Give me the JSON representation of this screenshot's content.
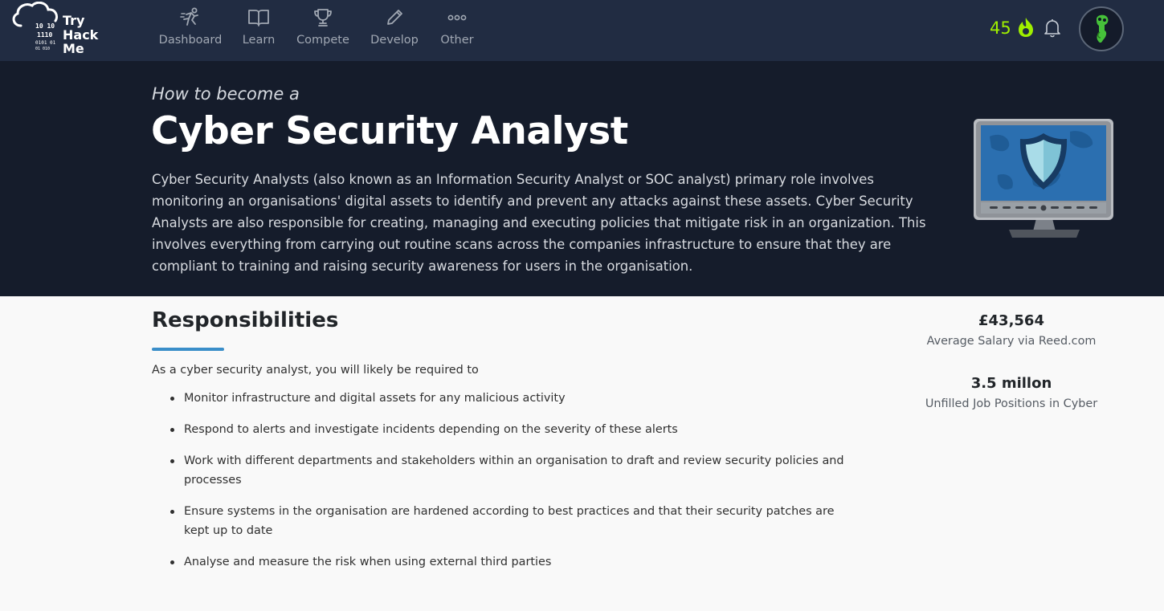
{
  "brand": {
    "logo_lines": [
      "Try",
      "Hack",
      "Me"
    ],
    "logo_binary": [
      "10  10",
      "1110",
      "0101  01",
      "01  010"
    ]
  },
  "nav": {
    "items": [
      {
        "label": "Dashboard",
        "icon": "runner-icon"
      },
      {
        "label": "Learn",
        "icon": "book-icon"
      },
      {
        "label": "Compete",
        "icon": "trophy-icon"
      },
      {
        "label": "Develop",
        "icon": "pencil-icon"
      },
      {
        "label": "Other",
        "icon": "dots-icon"
      }
    ],
    "streak": "45",
    "streak_icon": "flame-icon",
    "notification_icon": "bell-icon",
    "avatar_icon": "avatar-icon"
  },
  "hero": {
    "pre_title": "How to become a",
    "title": "Cyber Security Analyst",
    "description": "Cyber Security Analysts (also known as an Information Security Analyst or SOC analyst) primary role involves monitoring an organisations' digital assets to identify and prevent any attacks against these assets. Cyber Security Analysts are also responsible for creating, managing and executing policies that mitigate risk in an organization. This involves everything from carrying out routine scans across the companies infrastructure to ensure that they are compliant to training and raising security awareness for users in the organisation.",
    "illustration": "monitor-shield-icon"
  },
  "responsibilities": {
    "title": "Responsibilities",
    "intro": "As a cyber security analyst, you will likely be required to",
    "items": [
      "Monitor infrastructure and digital assets for any malicious activity",
      "Respond to alerts and investigate incidents depending on the severity of these alerts",
      "Work with different departments and stakeholders within an organisation to draft and review security policies and processes",
      "Ensure systems in the organisation are hardened according to best practices and that their security patches are kept up to date",
      "Analyse and measure the risk when using external third parties"
    ]
  },
  "stats": [
    {
      "value": "£43,564",
      "label": "Average Salary via Reed.com"
    },
    {
      "value": "3.5 millon",
      "label": "Unfilled Job Positions in Cyber"
    }
  ],
  "colors": {
    "navbar": "#212c42",
    "hero": "#151c2b",
    "accent_green": "#9fef00",
    "underline_blue": "#3a8ec9"
  }
}
